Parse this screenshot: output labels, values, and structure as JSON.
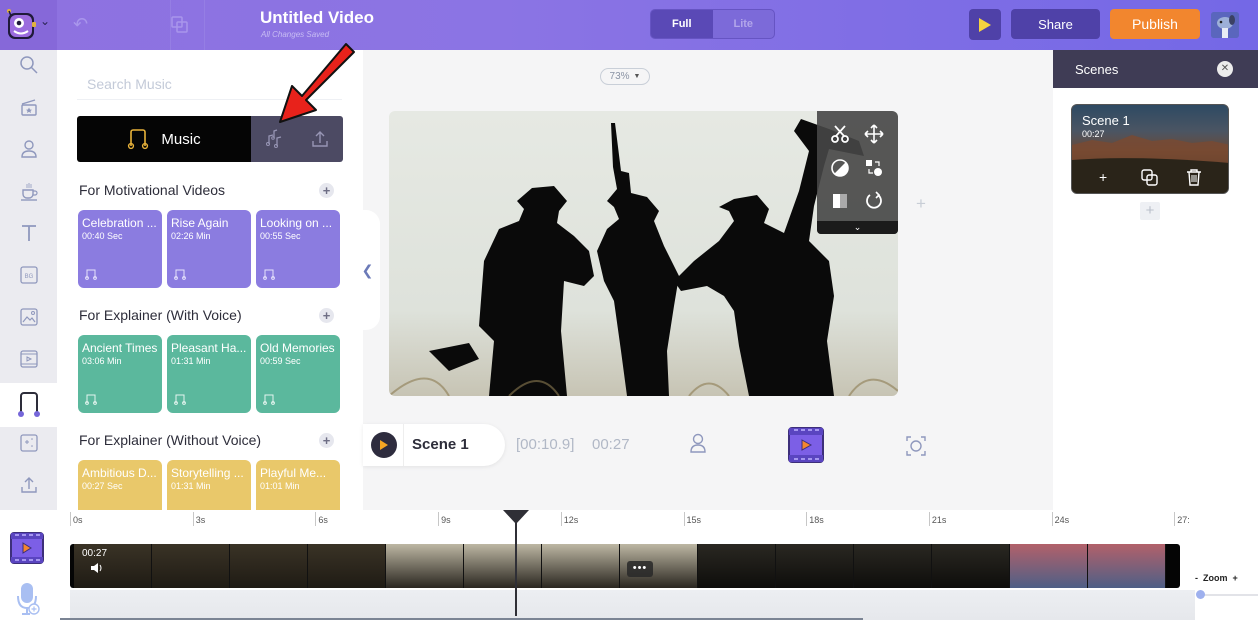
{
  "topbar": {
    "title": "Untitled Video",
    "save_status": "All Changes Saved",
    "mode_options": [
      "Full",
      "Lite"
    ],
    "mode_selected": "Full",
    "share_label": "Share",
    "publish_label": "Publish",
    "icons": [
      "undo-icon",
      "duplicate-icon",
      "play-icon"
    ]
  },
  "sidebar": {
    "items": [
      {
        "name": "search",
        "icon": "search-icon"
      },
      {
        "name": "scenes",
        "icon": "clapperboard-icon"
      },
      {
        "name": "characters",
        "icon": "character-icon"
      },
      {
        "name": "props",
        "icon": "coffee-cup-icon"
      },
      {
        "name": "text",
        "icon": "text-icon"
      },
      {
        "name": "backgrounds",
        "icon": "bg-icon"
      },
      {
        "name": "images",
        "icon": "image-icon"
      },
      {
        "name": "videos",
        "icon": "video-icon"
      },
      {
        "name": "music",
        "icon": "music-icon",
        "active": true
      },
      {
        "name": "effects",
        "icon": "sparkle-icon"
      },
      {
        "name": "upload",
        "icon": "upload-icon"
      }
    ]
  },
  "music_panel": {
    "search_placeholder": "Search Music",
    "search_value": "",
    "tabs": {
      "music_label": "Music",
      "sfx_icon": "sound-effects-icon",
      "upload_icon": "upload-icon"
    },
    "categories": [
      {
        "title": "For Motivational Videos",
        "color": "#8b7ce0",
        "tracks": [
          {
            "name": "Celebration ...",
            "duration": "00:40 Sec"
          },
          {
            "name": "Rise Again",
            "duration": "02:26 Min"
          },
          {
            "name": "Looking on ...",
            "duration": "00:55 Sec"
          }
        ]
      },
      {
        "title": "For Explainer (With Voice)",
        "color": "#5bb89d",
        "tracks": [
          {
            "name": "Ancient Times",
            "duration": "03:06 Min"
          },
          {
            "name": "Pleasant Ha...",
            "duration": "01:31 Min"
          },
          {
            "name": "Old Memories",
            "duration": "00:59 Sec"
          }
        ]
      },
      {
        "title": "For Explainer (Without Voice)",
        "color": "#e9c86a",
        "tracks": [
          {
            "name": "Ambitious D...",
            "duration": "00:27 Sec"
          },
          {
            "name": "Storytelling ...",
            "duration": "01:31 Min"
          },
          {
            "name": "Playful Me...",
            "duration": "01:01 Min"
          }
        ]
      }
    ]
  },
  "canvas": {
    "zoom_level": "73%",
    "tools": [
      "scissors-icon",
      "move-icon",
      "contrast-icon",
      "swap-icon",
      "opacity-icon",
      "rotate-icon"
    ]
  },
  "scene_controls": {
    "scene_name": "Scene 1",
    "current_time": "[00:10.9]",
    "duration": "00:27"
  },
  "scenes_panel": {
    "title": "Scenes",
    "scenes": [
      {
        "name": "Scene 1",
        "duration": "00:27"
      }
    ]
  },
  "timeline": {
    "ticks": [
      "0s",
      "3s",
      "6s",
      "9s",
      "12s",
      "15s",
      "18s",
      "21s",
      "24s",
      "27:"
    ],
    "track_duration": "00:27",
    "playhead_seconds": 10.9,
    "zoom_label": "Zoom",
    "zoom_minus": "-",
    "zoom_plus": "+",
    "zoom_value": 0
  },
  "colors": {
    "accent_purple": "#8b74e4",
    "publish_orange": "#f2862e",
    "panel_dark": "#3f3c55"
  }
}
